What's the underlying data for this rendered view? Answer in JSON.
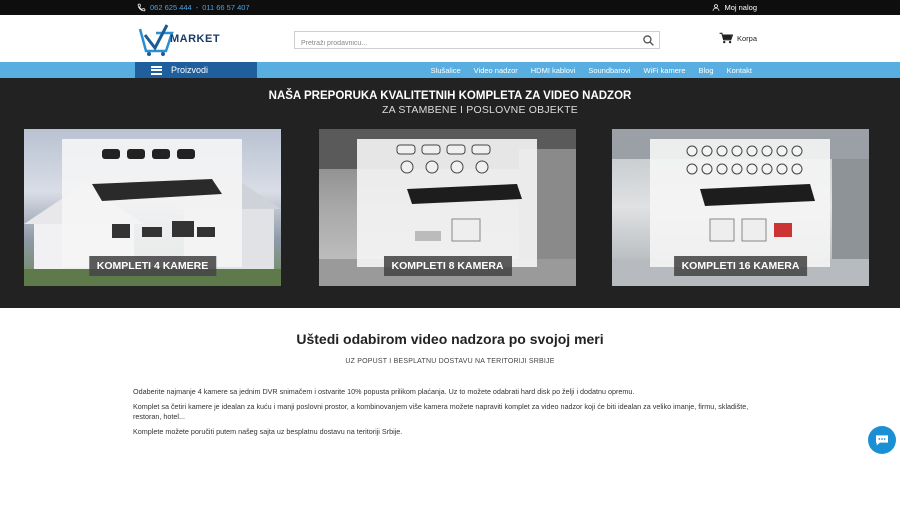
{
  "topbar": {
    "phone1": "062 625 444",
    "separator": "-",
    "phone2": "011 66 57 407",
    "account_label": "Moj nalog"
  },
  "header": {
    "logo_text": "MARKET",
    "search_placeholder": "Pretraži prodavnicu...",
    "cart_label": "Korpa"
  },
  "nav": {
    "products_label": "Proizvodi",
    "links": [
      "Slušalice",
      "Video nadzor",
      "HDMI kablovi",
      "Soundbarovi",
      "WiFi kamere",
      "Blog",
      "Kontakt"
    ]
  },
  "hero": {
    "title": "NAŠA PREPORUKA KVALITETNIH KOMPLETA ZA VIDEO NADZOR",
    "subtitle": "ZA STAMBENE I POSLOVNE OBJEKTE",
    "cards": [
      {
        "label": "KOMPLETI 4 KAMERE"
      },
      {
        "label": "KOMPLETI 8 KAMERA"
      },
      {
        "label": "KOMPLETI 16 KAMERA"
      }
    ]
  },
  "content": {
    "title": "Uštedi odabirom video nadzora po svojoj meri",
    "subtitle": "UZ POPUST I BESPLATNU DOSTAVU NA TERITORIJI SRBIJE",
    "paragraphs": [
      "Odaberite najmanje 4 kamere sa jednim DVR snimačem i ostvarite 10% popusta prilikom plaćanja. Uz to možete odabrati hard disk po želji i dodatnu opremu.",
      "Komplet sa četiri kamere je idealan za kuću i manji poslovni prostor, a kombinovanjem više kamera možete napraviti komplet za video nadzor koji će biti idealan za veliko imanje, firmu, skladište, restoran, hotel...",
      "Komplete možete poručiti putem našeg sajta uz besplatnu dostavu na teritoriji Srbije."
    ]
  },
  "colors": {
    "accent": "#58aee0",
    "nav_dark": "#1f5f9e",
    "topbar": "#0e0e0e",
    "hero_bg": "#222222",
    "chat": "#1b8fd4"
  }
}
